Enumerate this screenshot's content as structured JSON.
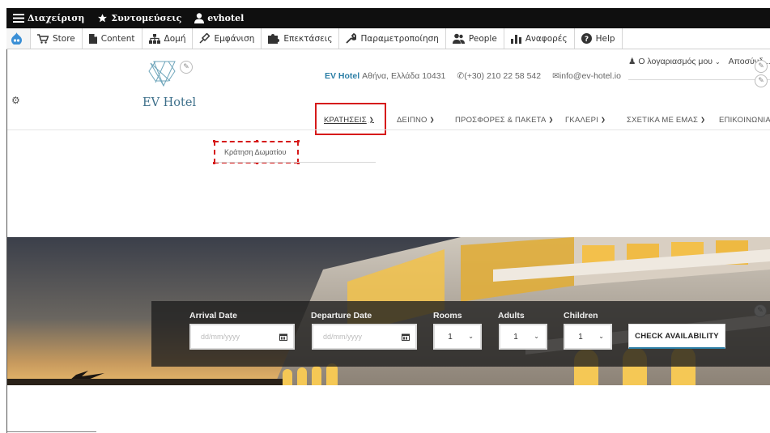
{
  "admin_bar": {
    "manage_label": "Διαχείριση",
    "shortcuts_label": "Συντομεύσεις",
    "user_label": "evhotel"
  },
  "tray": {
    "items": [
      {
        "label": "Store",
        "icon": "cart-icon"
      },
      {
        "label": "Content",
        "icon": "document-icon"
      },
      {
        "label": "Δομή",
        "icon": "sitemap-icon"
      },
      {
        "label": "Εμφάνιση",
        "icon": "paint-icon"
      },
      {
        "label": "Επεκτάσεις",
        "icon": "puzzle-icon"
      },
      {
        "label": "Παραμετροποίηση",
        "icon": "wrench-icon"
      },
      {
        "label": "People",
        "icon": "people-icon"
      },
      {
        "label": "Αναφορές",
        "icon": "bar-chart-icon"
      },
      {
        "label": "Help",
        "icon": "question-icon"
      }
    ]
  },
  "header": {
    "logo_text": "EV Hotel",
    "brand": "EV Hotel",
    "address": "Αθήνα, Ελλάδα 10431",
    "phone": "(+30) 210 22 58 542",
    "email": "info@ev-hotel.io",
    "account_label": "Ο λογαριασμός μου",
    "logout_label": "Αποσύνδ..."
  },
  "nav": {
    "items": [
      {
        "label": "ΚΡΑΤΗΣΕΙΣ"
      },
      {
        "label": "ΔΕΙΠΝΟ"
      },
      {
        "label": "ΠΡΟΣΦΟΡΕΣ & ΠΑΚΕΤΑ"
      },
      {
        "label": "ΓΚΑΛΕΡΙ"
      },
      {
        "label": "ΣΧΕΤΙΚΑ ΜΕ ΕΜΑΣ"
      },
      {
        "label": "ΕΠΙΚΟΙΝΩΝΙΑ"
      }
    ]
  },
  "dropdown": {
    "item_label": "Κράτηση Δωματίου"
  },
  "booking": {
    "arrival_label": "Arrival Date",
    "departure_label": "Departure Date",
    "rooms_label": "Rooms",
    "adults_label": "Adults",
    "children_label": "Children",
    "date_placeholder": "dd/mm/yyyy",
    "rooms_value": "1",
    "adults_value": "1",
    "children_value": "1",
    "check_label": "CHECK AVAILABILITY"
  },
  "colors": {
    "accent": "#2d7fa6",
    "highlight": "#d61a1a",
    "admin_bar": "#0f0f0f"
  }
}
